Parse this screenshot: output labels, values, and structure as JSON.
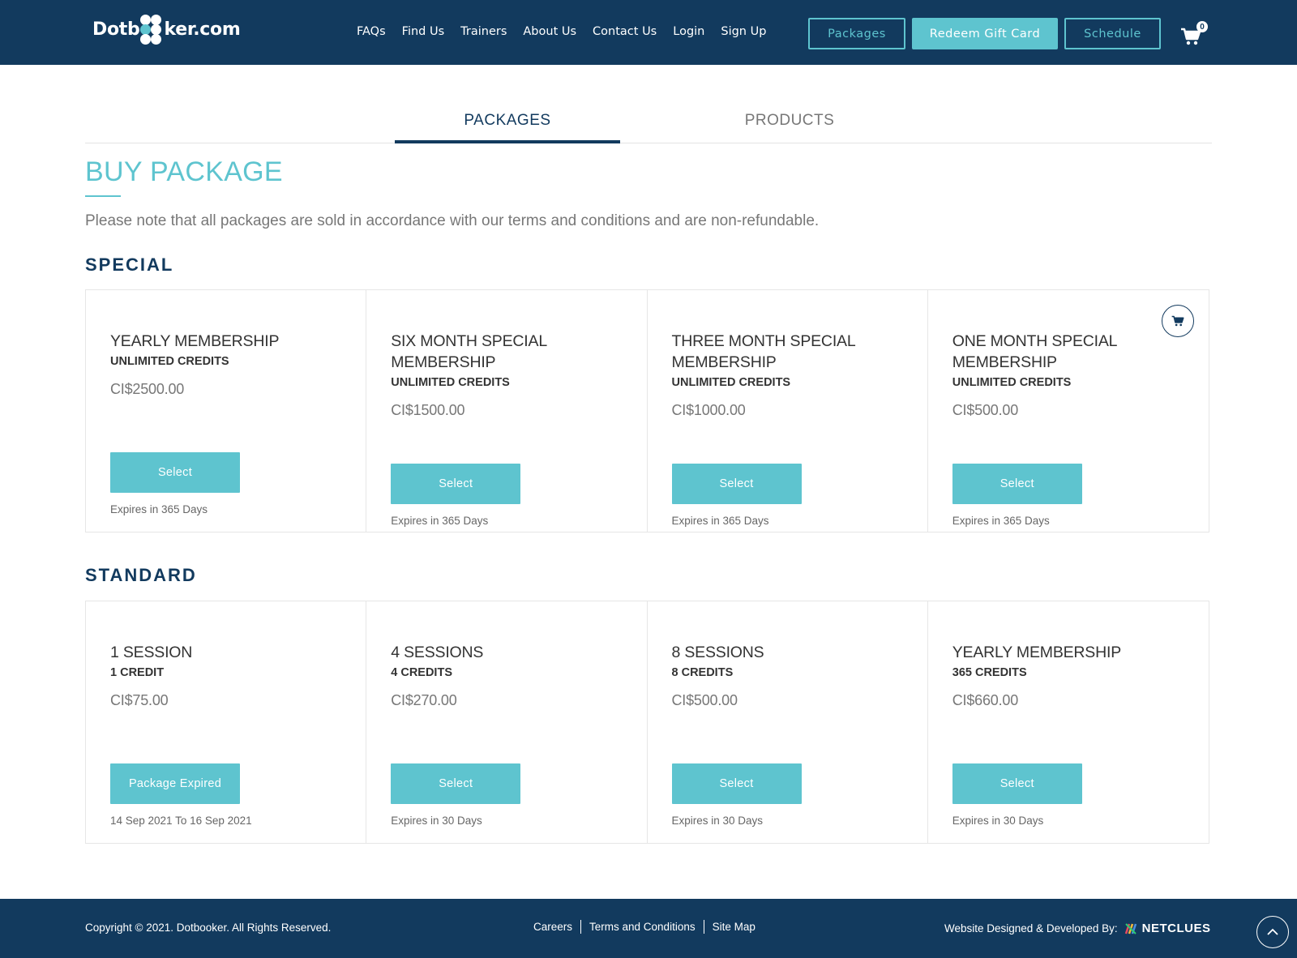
{
  "brand": {
    "logo_text_left": "Dotb",
    "logo_text_right": "ker.com"
  },
  "nav": {
    "items": [
      "FAQs",
      "Find Us",
      "Trainers",
      "About Us",
      "Contact Us",
      "Login",
      "Sign Up"
    ],
    "packages_button": "Packages",
    "gift_button": "Redeem Gift Card",
    "schedule_button": "Schedule",
    "cart_count": "0"
  },
  "tabs": {
    "packages": "PACKAGES",
    "products": "PRODUCTS"
  },
  "page": {
    "title": "BUY PACKAGE",
    "note": "Please note that all packages are sold in accordance with our terms and conditions and are non-refundable."
  },
  "sections": [
    {
      "title": "SPECIAL",
      "packages": [
        {
          "name": "YEARLY MEMBERSHIP",
          "credits": "UNLIMITED CREDITS",
          "price": "CI$2500.00",
          "button": "Select",
          "expiry": "Expires in 365 Days"
        },
        {
          "name": "SIX MONTH SPECIAL MEMBERSHIP",
          "credits": "UNLIMITED CREDITS",
          "price": "CI$1500.00",
          "button": "Select",
          "expiry": "Expires in 365 Days"
        },
        {
          "name": "THREE MONTH SPECIAL MEMBERSHIP",
          "credits": "UNLIMITED CREDITS",
          "price": "CI$1000.00",
          "button": "Select",
          "expiry": "Expires in 365 Days"
        },
        {
          "name": "ONE MONTH SPECIAL MEMBERSHIP",
          "credits": "UNLIMITED CREDITS",
          "price": "CI$500.00",
          "button": "Select",
          "expiry": "Expires in 365 Days"
        }
      ]
    },
    {
      "title": "STANDARD",
      "packages": [
        {
          "name": "1 SESSION",
          "credits": "1 CREDIT",
          "price": "CI$75.00",
          "button": "Package Expired",
          "expiry": "14 Sep 2021 To 16 Sep 2021"
        },
        {
          "name": "4 SESSIONS",
          "credits": "4 CREDITS",
          "price": "CI$270.00",
          "button": "Select",
          "expiry": "Expires in 30 Days"
        },
        {
          "name": "8 SESSIONS",
          "credits": "8 CREDITS",
          "price": "CI$500.00",
          "button": "Select",
          "expiry": "Expires in 30 Days"
        },
        {
          "name": "YEARLY MEMBERSHIP",
          "credits": "365 CREDITS",
          "price": "CI$660.00",
          "button": "Select",
          "expiry": "Expires in 30 Days"
        }
      ]
    }
  ],
  "footer": {
    "copyright": "Copyright © 2021. Dotbooker. All Rights Reserved.",
    "links": [
      "Careers",
      "Terms and Conditions",
      "Site Map"
    ],
    "credit_label": "Website Designed & Developed By:",
    "credit_brand": "NETCLUES"
  },
  "icons": {
    "cart": "shopping-cart-icon",
    "scroll_top": "chevron-up-icon"
  },
  "colors": {
    "header": "#123a5e",
    "accent": "#5ec4cf",
    "text": "#333333"
  }
}
